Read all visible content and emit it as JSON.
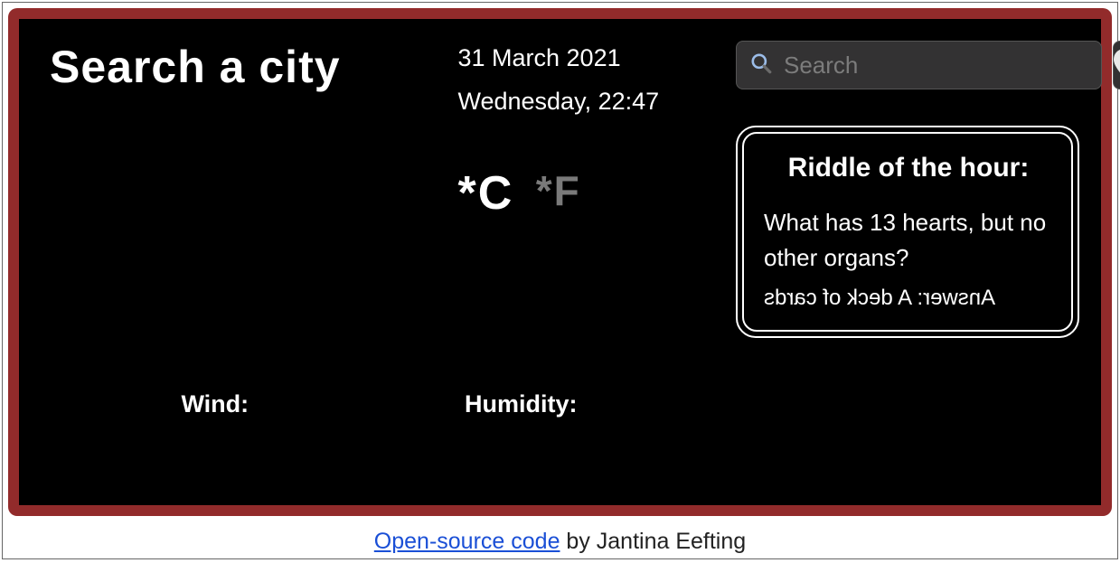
{
  "header": {
    "title": "Search a city"
  },
  "datetime": {
    "date": "31 March 2021",
    "day_time": "Wednesday, 22:47"
  },
  "units": {
    "celsius": "*C",
    "fahrenheit": "*F"
  },
  "stats": {
    "wind_label": "Wind:",
    "humidity_label": "Humidity:"
  },
  "search": {
    "placeholder": "Search"
  },
  "riddle": {
    "title": "Riddle of the hour:",
    "question": "What has 13 hearts, but no other organs?",
    "answer": "Answer: A deck of cards"
  },
  "footer": {
    "link_text": "Open-source code",
    "by_text": " by Jantina Eefting"
  }
}
